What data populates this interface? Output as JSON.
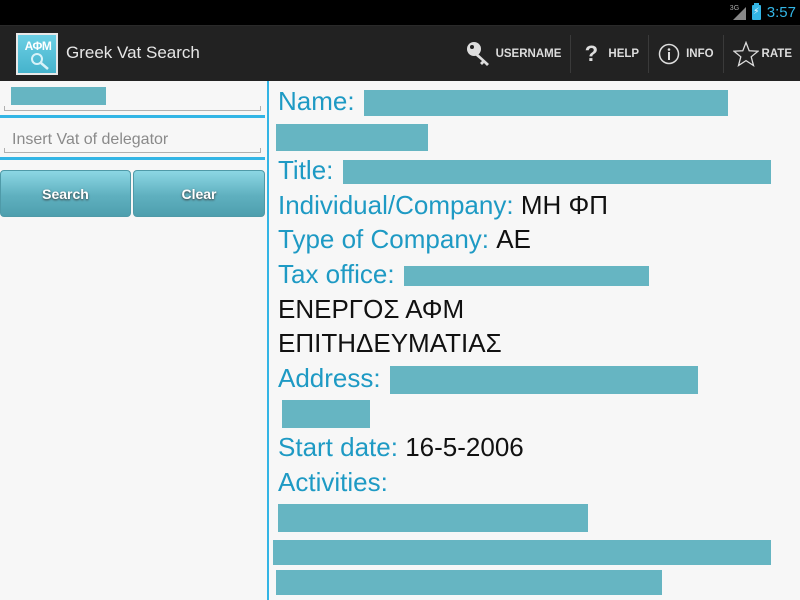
{
  "status_bar": {
    "network_type": "3G",
    "time": "3:57"
  },
  "action_bar": {
    "app_icon_text": "ΑΦΜ",
    "title": "Greek Vat Search",
    "actions": [
      {
        "id": "username",
        "label": "USERNAME",
        "icon": "key-icon"
      },
      {
        "id": "help",
        "label": "HELP",
        "icon": "question-icon"
      },
      {
        "id": "info",
        "label": "INFO",
        "icon": "info-icon"
      },
      {
        "id": "rate",
        "label": "RATE",
        "icon": "star-icon"
      }
    ]
  },
  "search_form": {
    "vat_input": {
      "value": "[redacted]",
      "redacted": true
    },
    "delegator_input": {
      "value": "",
      "placeholder": "Insert Vat of delegator"
    },
    "search_label": "Search",
    "clear_label": "Clear"
  },
  "result": {
    "name_label": "Name:",
    "name_value": "[redacted]",
    "title_label": "Title:",
    "title_value": "[redacted]",
    "individual_company_label": "Individual/Company:",
    "individual_company_value": "ΜΗ ΦΠ",
    "type_label": "Type of Company:",
    "type_value": "ΑΕ",
    "tax_office_label": "Tax office:",
    "tax_office_value": "[redacted]",
    "status_line_1": "ΕΝΕΡΓΟΣ ΑΦΜ",
    "status_line_2": "ΕΠΙΤΗΔΕΥΜΑΤΙΑΣ",
    "address_label": "Address:",
    "address_value": "[redacted]",
    "start_date_label": "Start date:",
    "start_date_value": "16-5-2006",
    "activities_label": "Activities:",
    "activities_values": [
      "[redacted]",
      "[redacted]",
      "[redacted]"
    ]
  },
  "colors": {
    "accent": "#33b5e5",
    "label_blue": "#1e9ac4",
    "redaction": "#66b5c2",
    "action_bar_bg": "#222222"
  }
}
